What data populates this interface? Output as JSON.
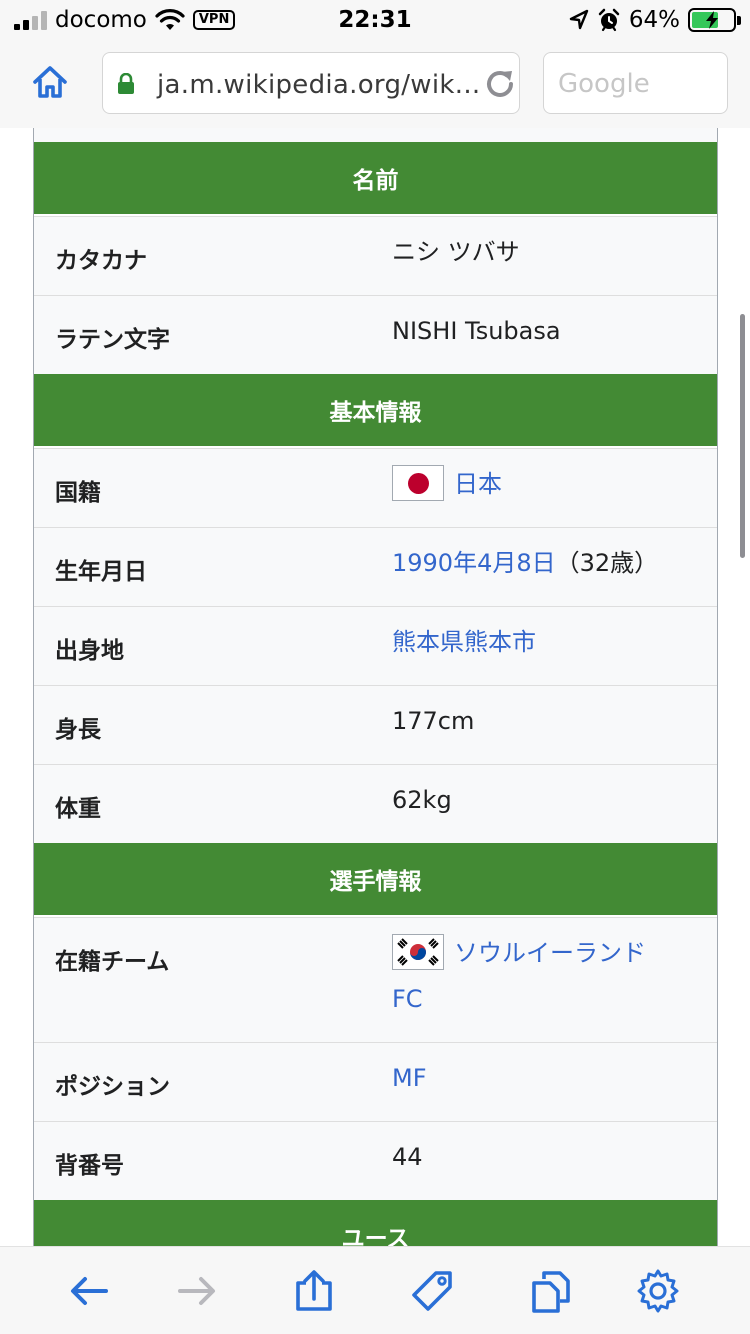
{
  "status_bar": {
    "carrier": "docomo",
    "vpn_label": "VPN",
    "time": "22:31",
    "battery_percent": "64%",
    "battery_level": 0.64,
    "signal_bars_active": 2,
    "signal_bars_total": 4
  },
  "browser": {
    "url": "ja.m.wikipedia.org/wik...",
    "search_placeholder": "Google"
  },
  "infobox": {
    "sections": {
      "name": "名前",
      "basic": "基本情報",
      "player": "選手情報",
      "youth": "ユース"
    },
    "rows": {
      "katakana": {
        "label": "カタカナ",
        "value": "ニシ ツバサ"
      },
      "latin": {
        "label": "ラテン文字",
        "value": "NISHI Tsubasa"
      },
      "nationality": {
        "label": "国籍",
        "value": "日本"
      },
      "birthdate": {
        "label": "生年月日",
        "value": "1990年4月8日",
        "suffix": "（32歳）"
      },
      "birthplace": {
        "label": "出身地",
        "value": "熊本県熊本市"
      },
      "height": {
        "label": "身長",
        "value": "177cm"
      },
      "weight": {
        "label": "体重",
        "value": "62kg"
      },
      "team": {
        "label": "在籍チーム",
        "value": "ソウルイーランド",
        "value2": "FC"
      },
      "position": {
        "label": "ポジション",
        "value": "MF"
      },
      "number": {
        "label": "背番号",
        "value": "44"
      }
    }
  },
  "colors": {
    "section_green": "#438a34",
    "link_blue": "#3366cc",
    "toolbar_blue": "#2a6fd6"
  },
  "toolbar": {
    "icons": [
      "back-arrow-icon",
      "forward-arrow-icon",
      "share-icon",
      "tag-icon",
      "tabs-icon",
      "settings-icon"
    ]
  }
}
